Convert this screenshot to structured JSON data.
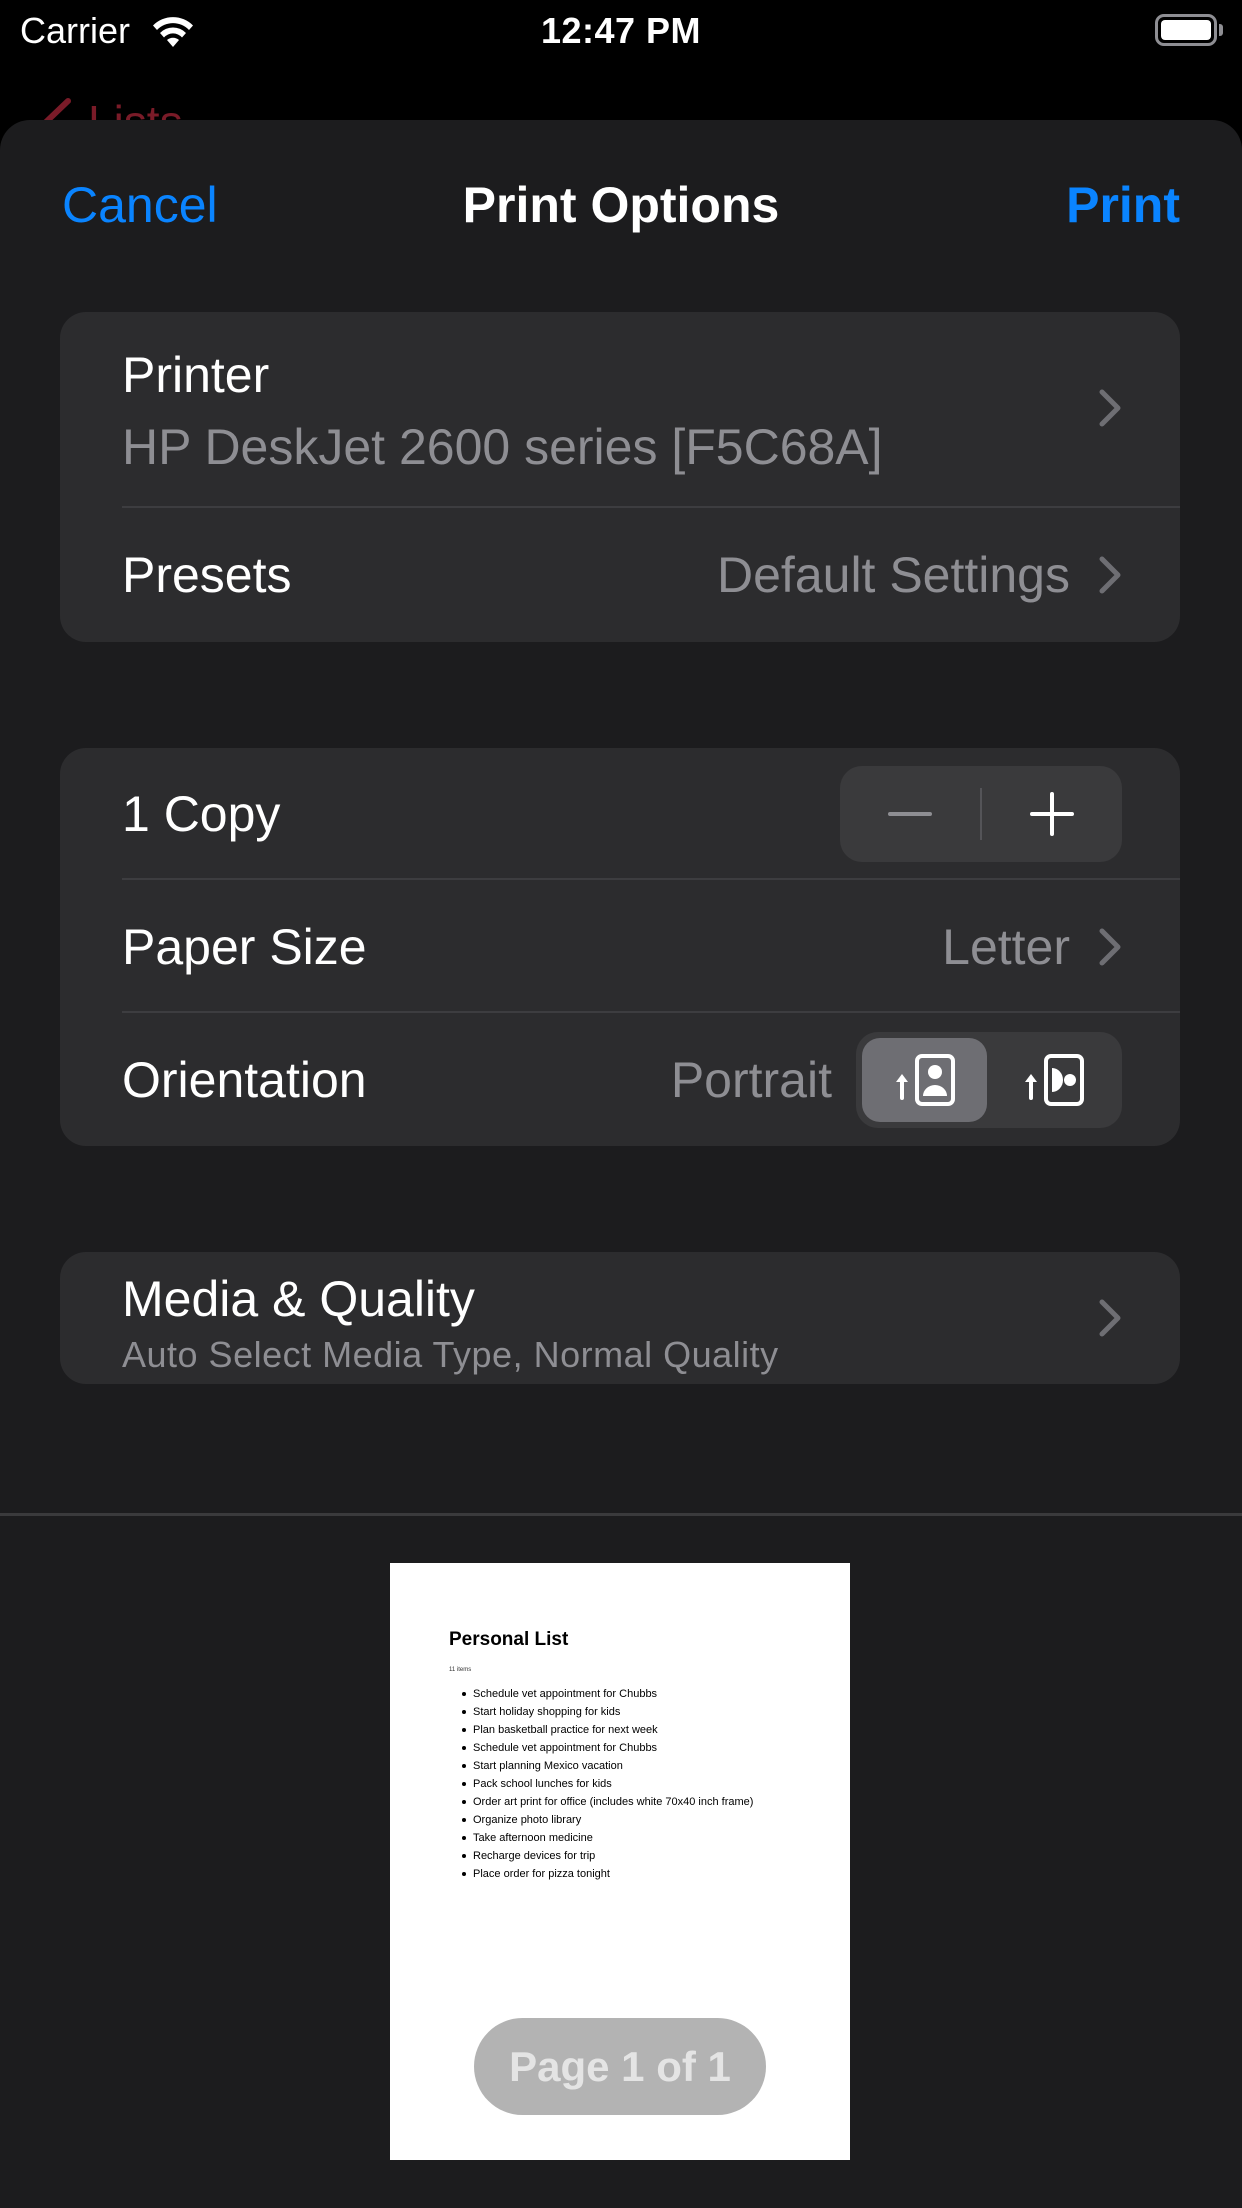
{
  "status_bar": {
    "carrier": "Carrier",
    "time": "12:47 PM",
    "wifi_icon": "wifi-icon",
    "battery_icon": "battery-full-icon"
  },
  "background": {
    "back_label": "Lists",
    "back_color": "#7a1b28"
  },
  "nav": {
    "cancel_label": "Cancel",
    "title": "Print Options",
    "print_label": "Print",
    "accent_color": "#0a84ff"
  },
  "printer": {
    "label": "Printer",
    "value": "HP DeskJet 2600 series [F5C68A]"
  },
  "presets": {
    "label": "Presets",
    "value": "Default Settings"
  },
  "copies": {
    "label": "1 Copy",
    "count": 1,
    "decrement_icon": "minus-icon",
    "increment_icon": "plus-icon"
  },
  "paper_size": {
    "label": "Paper Size",
    "value": "Letter"
  },
  "orientation": {
    "label": "Orientation",
    "value": "Portrait",
    "options": [
      {
        "name": "Portrait",
        "icon": "portrait-orientation-icon",
        "selected": true
      },
      {
        "name": "Landscape",
        "icon": "landscape-orientation-icon",
        "selected": false
      }
    ]
  },
  "media_quality": {
    "label": "Media & Quality",
    "value": "Auto Select Media Type, Normal Quality"
  },
  "preview": {
    "doc_title": "Personal List",
    "doc_count": "11 items",
    "items": [
      "Schedule vet appointment for Chubbs",
      "Start holiday shopping for kids",
      "Plan basketball practice for next week",
      "Schedule vet appointment for Chubbs",
      "Start planning Mexico vacation",
      "Pack school lunches for kids",
      "Order art print for office (includes white 70x40 inch frame)",
      "Organize photo library",
      "Take afternoon medicine",
      "Recharge devices for trip",
      "Place order for pizza tonight"
    ],
    "page_indicator": "Page 1 of 1"
  }
}
